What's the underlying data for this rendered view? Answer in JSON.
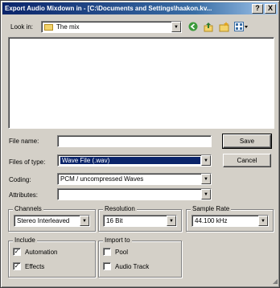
{
  "window": {
    "title": "Export Audio Mixdown in - [C:\\Documents and Settings\\haakon.kv...",
    "help_glyph": "?",
    "close_glyph": "X"
  },
  "lookin": {
    "label": "Look in:",
    "value": "The mix"
  },
  "toolbar": {
    "back_icon": "back-arrow-icon",
    "up_icon": "up-folder-icon",
    "newfolder_icon": "new-folder-icon",
    "view_icon": "view-menu-icon"
  },
  "filename": {
    "label": "File name:",
    "value": ""
  },
  "filetype": {
    "label": "Files of type:",
    "value": "Wave File (.wav)"
  },
  "coding": {
    "label": "Coding:",
    "value": "PCM / uncompressed Waves"
  },
  "attributes": {
    "label": "Attributes:",
    "value": ""
  },
  "buttons": {
    "save": "Save",
    "cancel": "Cancel"
  },
  "channels": {
    "title": "Channels",
    "value": "Stereo Interleaved"
  },
  "resolution": {
    "title": "Resolution",
    "value": "16 Bit"
  },
  "sample_rate": {
    "title": "Sample Rate",
    "value": "44.100 kHz"
  },
  "include": {
    "title": "Include",
    "automation": {
      "label": "Automation",
      "checked": true
    },
    "effects": {
      "label": "Effects",
      "checked": true
    }
  },
  "import_to": {
    "title": "Import to",
    "pool": {
      "label": "Pool",
      "checked": false
    },
    "audio_track": {
      "label": "Audio Track",
      "checked": false
    }
  },
  "colors": {
    "titlebar": "#0a246a",
    "face": "#d4d0c8",
    "selection": "#0a246a"
  }
}
